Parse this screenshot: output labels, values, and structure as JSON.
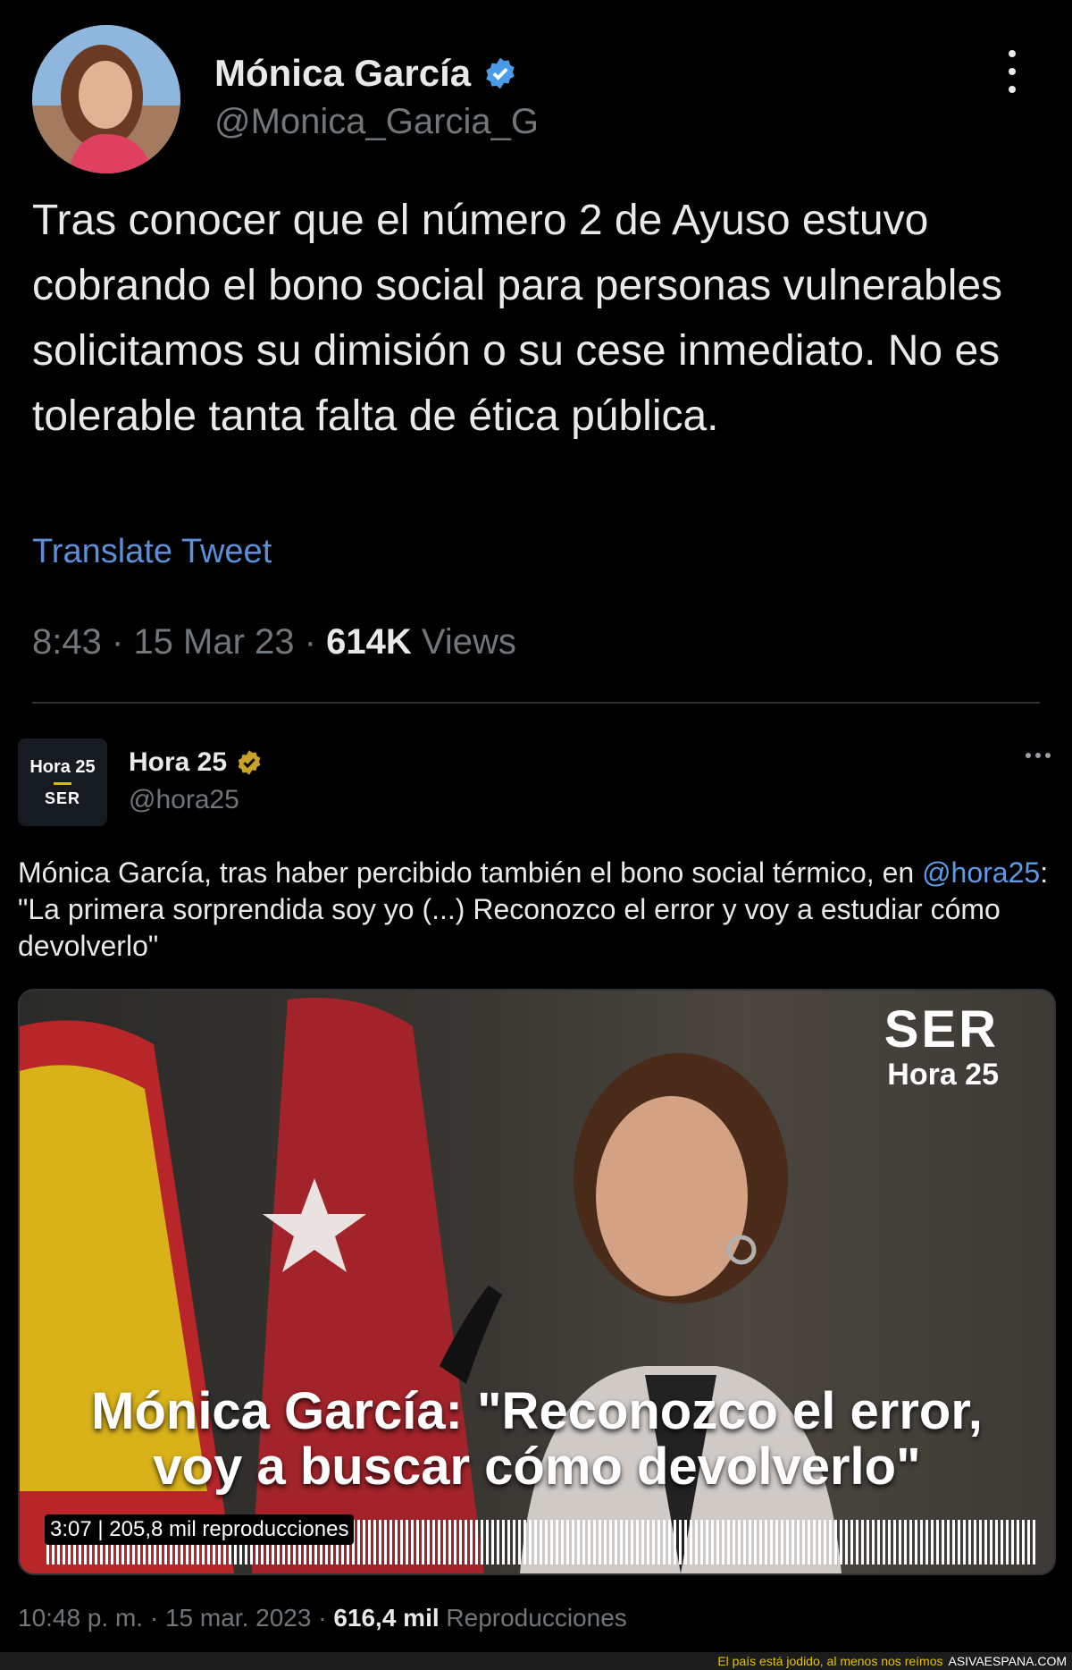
{
  "tweet1": {
    "author_name": "Mónica García",
    "handle": "@Monica_Garcia_G",
    "verified_badge_color": "#4a9ce8",
    "text": "Tras conocer que el número 2 de Ayuso estuvo cobrando el bono social para personas vulnerables solicitamos su dimisión o su cese inmediato. No es tolerable tanta falta de ética pública.",
    "translate_label": "Translate Tweet",
    "time": "8:43",
    "date": "15 Mar 23",
    "views_count": "614K",
    "views_label": "Views",
    "separator": "·"
  },
  "tweet2": {
    "avatar_line1": "Hora 25",
    "avatar_line2": "SER",
    "author_name": "Hora 25",
    "handle": "@hora25",
    "verified_badge_color": "#c9a227",
    "text_before_mention": "Mónica García, tras haber percibido también el bono social térmico, en ",
    "mention": "@hora25",
    "text_after_mention": ": \"La primera sorprendida soy yo (...) Reconozco el error y voy a estudiar cómo devolverlo\"",
    "video": {
      "logo_top": "SER",
      "logo_bottom": "Hora 25",
      "caption_line1": "Mónica García: \"Reconozco el error,",
      "caption_line2": "voy a buscar cómo devolverlo\"",
      "duration": "3:07",
      "plays": "205,8 mil reproducciones"
    },
    "time": "10:48 p. m.",
    "date": "15 mar. 2023",
    "plays_count": "616,4 mil",
    "plays_label": "Reproducciones",
    "separator": "·"
  },
  "watermark": {
    "tagline": "El país está jodido, al menos nos reímos",
    "site": "ASIVAESPANA.COM"
  }
}
